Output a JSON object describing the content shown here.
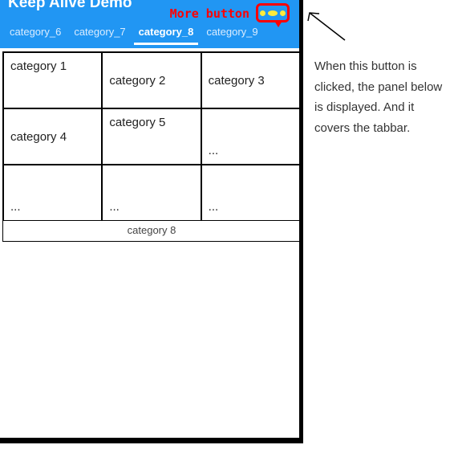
{
  "header": {
    "title": "Keep Alive Demo",
    "more_label": "More button"
  },
  "tabs": [
    {
      "label": "category_6",
      "active": false
    },
    {
      "label": "category_7",
      "active": false
    },
    {
      "label": "category_8",
      "active": true
    },
    {
      "label": "category_9",
      "active": false
    }
  ],
  "grid": {
    "rows": [
      [
        "category 1",
        "category 2",
        "category 3"
      ],
      [
        "category 4",
        "category 5",
        "..."
      ],
      [
        "...",
        "...",
        "..."
      ]
    ],
    "footer": "category 8"
  },
  "annotation": {
    "text": "When this button is clicked, the panel below is displayed. And it covers the tabbar."
  }
}
